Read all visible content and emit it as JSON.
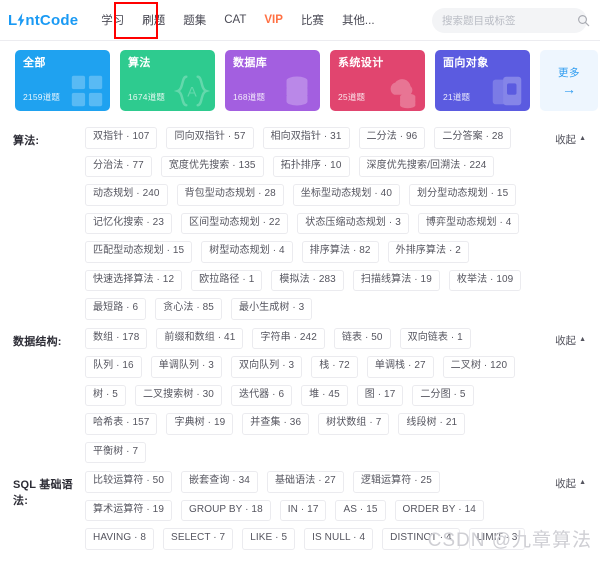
{
  "header": {
    "logo": {
      "pre": "L",
      "bolt": "⚡",
      "post": "ntCode",
      "full": "LintCode"
    },
    "nav": [
      {
        "label": "学习",
        "state": "normal"
      },
      {
        "label": "刷题",
        "state": "active"
      },
      {
        "label": "题集",
        "state": "normal"
      },
      {
        "label": "CAT",
        "state": "normal"
      },
      {
        "label": "VIP",
        "state": "vip"
      },
      {
        "label": "比赛",
        "state": "normal"
      },
      {
        "label": "其他...",
        "state": "normal"
      }
    ],
    "search": {
      "placeholder": "搜索题目或标签",
      "value": "",
      "icon": "search-icon"
    },
    "annotation": {
      "color": "#ff0000",
      "target": "刷题"
    }
  },
  "category_cards": [
    {
      "title": "全部",
      "count": "2159道题",
      "color": "#1fa2f0",
      "icon": "grid-icon"
    },
    {
      "title": "算法",
      "count": "1674道题",
      "color": "#2ecb8f",
      "icon": "braces-icon"
    },
    {
      "title": "数据库",
      "count": "168道题",
      "color": "#a35fe0",
      "icon": "database-icon"
    },
    {
      "title": "系统设计",
      "count": "25道题",
      "color": "#e1456f",
      "icon": "cloud-stack-icon"
    },
    {
      "title": "面向对象",
      "count": "21道题",
      "color": "#5b5be0",
      "icon": "cards-icon"
    }
  ],
  "more_card": {
    "label": "更多",
    "arrow": "→",
    "color": "#2e9cf0"
  },
  "sections": [
    {
      "label": "算法:",
      "collapse_label": "收起",
      "collapse_caret": "▲",
      "tags": [
        "双指针 · 107",
        "同向双指针 · 57",
        "相向双指针 · 31",
        "二分法 · 96",
        "二分答案 · 28",
        "分治法 · 77",
        "宽度优先搜索 · 135",
        "拓扑排序 · 10",
        "深度优先搜索/回溯法 · 224",
        "动态规划 · 240",
        "背包型动态规划 · 28",
        "坐标型动态规划 · 40",
        "划分型动态规划 · 15",
        "记忆化搜索 · 23",
        "区间型动态规划 · 22",
        "状态压缩动态规划 · 3",
        "博弈型动态规划 · 4",
        "匹配型动态规划 · 15",
        "树型动态规划 · 4",
        "排序算法 · 82",
        "外排序算法 · 2",
        "快速选择算法 · 12",
        "欧拉路径 · 1",
        "模拟法 · 283",
        "扫描线算法 · 19",
        "枚举法 · 109",
        "最短路 · 6",
        "贪心法 · 85",
        "最小生成树 · 3"
      ]
    },
    {
      "label": "数据结构:",
      "collapse_label": "收起",
      "collapse_caret": "▲",
      "tags": [
        "数组 · 178",
        "前缀和数组 · 41",
        "字符串 · 242",
        "链表 · 50",
        "双向链表 · 1",
        "队列 · 16",
        "单调队列 · 3",
        "双向队列 · 3",
        "栈 · 72",
        "单调栈 · 27",
        "二叉树 · 120",
        "树 · 5",
        "二叉搜索树 · 30",
        "迭代器 · 6",
        "堆 · 45",
        "图 · 17",
        "二分图 · 5",
        "哈希表 · 157",
        "字典树 · 19",
        "并查集 · 36",
        "树状数组 · 7",
        "线段树 · 21",
        "平衡树 · 7"
      ]
    },
    {
      "label": "SQL 基础语法:",
      "collapse_label": "收起",
      "collapse_caret": "▲",
      "tags": [
        "比较运算符 · 50",
        "嵌套查询 · 34",
        "基础语法 · 27",
        "逻辑运算符 · 25",
        "算术运算符 · 19",
        "GROUP BY · 18",
        "IN · 17",
        "AS · 15",
        "ORDER BY · 14",
        "HAVING · 8",
        "SELECT · 7",
        "LIKE · 5",
        "IS NULL · 4",
        "DISTINCT · 4",
        "LIMIT · 3"
      ]
    }
  ],
  "watermark": {
    "text": "CSDN @九章算法"
  }
}
